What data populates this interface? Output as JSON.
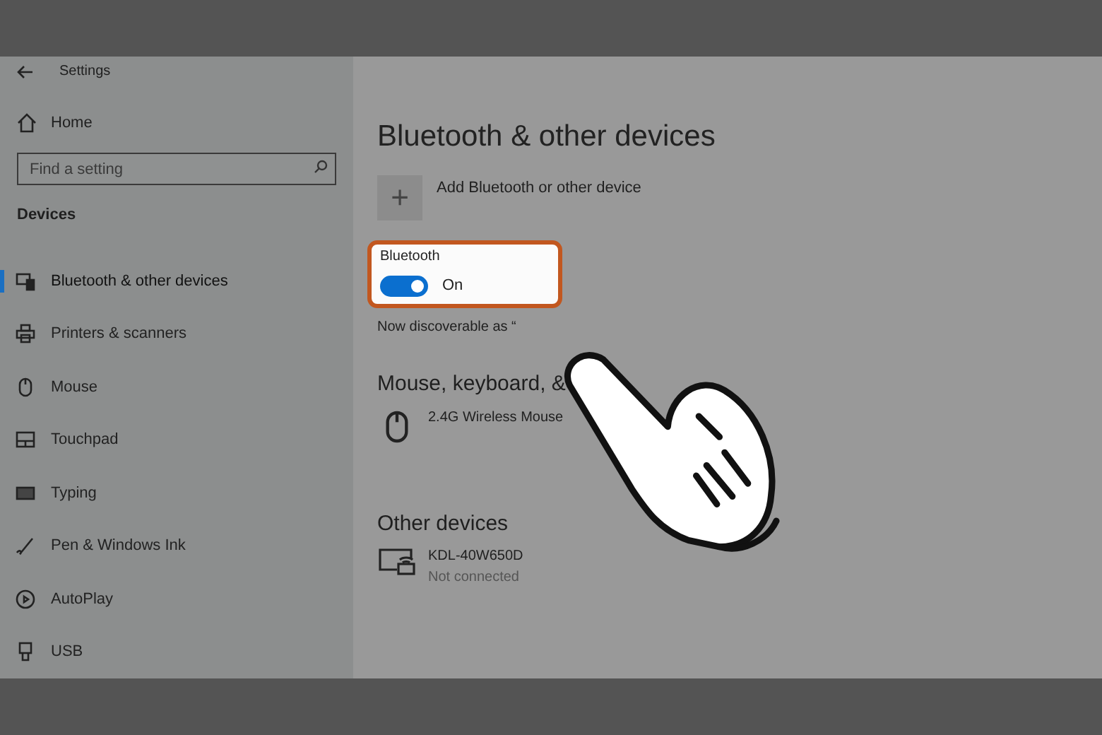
{
  "window": {
    "title": "Settings"
  },
  "sidebar": {
    "home": "Home",
    "search": {
      "placeholder": "Find a setting"
    },
    "section": "Devices",
    "items": [
      {
        "label": "Bluetooth & other devices",
        "kind": "devices",
        "selected": true
      },
      {
        "label": "Printers & scanners",
        "kind": "printer",
        "selected": false
      },
      {
        "label": "Mouse",
        "kind": "mouse",
        "selected": false
      },
      {
        "label": "Touchpad",
        "kind": "touchpad",
        "selected": false
      },
      {
        "label": "Typing",
        "kind": "keyboard",
        "selected": false
      },
      {
        "label": "Pen & Windows Ink",
        "kind": "pen",
        "selected": false
      },
      {
        "label": "AutoPlay",
        "kind": "autoplay",
        "selected": false
      },
      {
        "label": "USB",
        "kind": "usb",
        "selected": false
      }
    ]
  },
  "main": {
    "title": "Bluetooth & other devices",
    "add_button": {
      "symbol": "+",
      "label": "Add Bluetooth or other device"
    },
    "bluetooth": {
      "label": "Bluetooth",
      "on": true,
      "state_text": "On",
      "discoverable": "Now discoverable as “"
    },
    "sections": [
      {
        "heading": "Mouse, keyboard, &",
        "devices": [
          {
            "kind": "mouse",
            "name": "2.4G Wireless Mouse"
          }
        ]
      },
      {
        "heading": "Other devices",
        "devices": [
          {
            "kind": "display",
            "name": "KDL-40W650D",
            "status": "Not connected"
          }
        ]
      }
    ]
  }
}
